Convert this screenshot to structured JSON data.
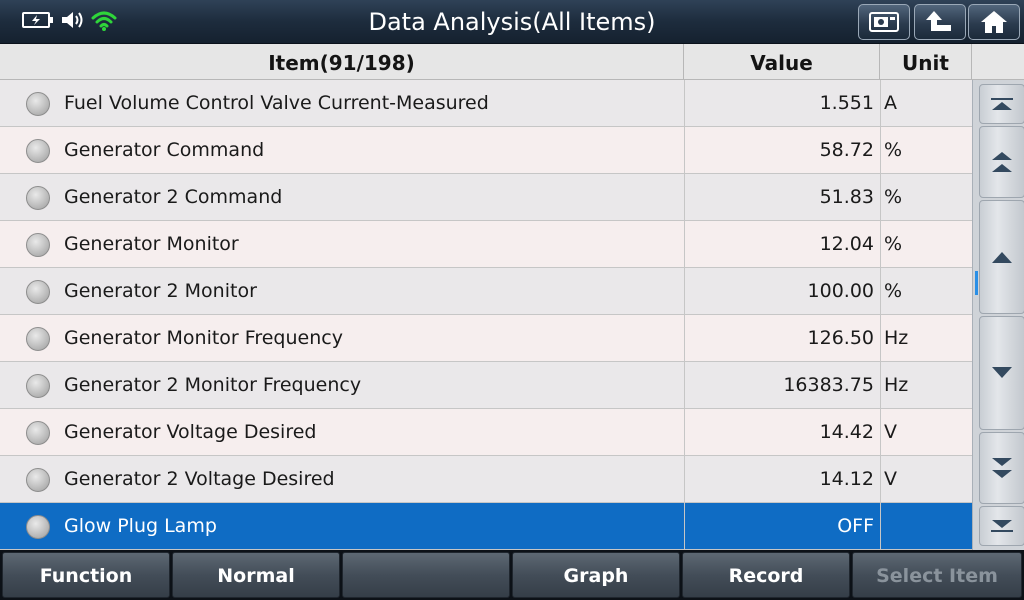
{
  "title": "Data Analysis(All Items)",
  "status_icons": [
    "battery-charging-icon",
    "speaker-icon",
    "wifi-icon"
  ],
  "title_buttons": [
    "screenshot-icon",
    "back-icon",
    "home-icon"
  ],
  "table": {
    "headers": {
      "item": "Item(91/198)",
      "value": "Value",
      "unit": "Unit"
    },
    "rows": [
      {
        "name": "Fuel Volume Control Valve Current-Measured",
        "value": "1.551",
        "unit": "A",
        "selected": false
      },
      {
        "name": "Generator Command",
        "value": "58.72",
        "unit": "%",
        "selected": false
      },
      {
        "name": "Generator 2 Command",
        "value": "51.83",
        "unit": "%",
        "selected": false
      },
      {
        "name": "Generator Monitor",
        "value": "12.04",
        "unit": "%",
        "selected": false
      },
      {
        "name": "Generator 2 Monitor",
        "value": "100.00",
        "unit": "%",
        "selected": false
      },
      {
        "name": "Generator Monitor Frequency",
        "value": "126.50",
        "unit": "Hz",
        "selected": false
      },
      {
        "name": "Generator 2 Monitor Frequency",
        "value": "16383.75",
        "unit": "Hz",
        "selected": false
      },
      {
        "name": "Generator Voltage Desired",
        "value": "14.42",
        "unit": "V",
        "selected": false
      },
      {
        "name": "Generator 2 Voltage Desired",
        "value": "14.12",
        "unit": "V",
        "selected": false
      },
      {
        "name": "Glow Plug Lamp",
        "value": "OFF",
        "unit": "",
        "selected": true
      }
    ]
  },
  "scroll_buttons": [
    "scroll-top-icon",
    "page-up-icon",
    "line-up-icon",
    "line-down-icon",
    "page-down-icon",
    "scroll-bottom-icon"
  ],
  "footer": {
    "function": "Function",
    "normal": "Normal",
    "blank": "",
    "graph": "Graph",
    "record": "Record",
    "select_item": "Select Item"
  },
  "colors": {
    "selected_row": "#0f6cc4",
    "scroll_thumb": "#2a8fe6",
    "wifi": "#2fd63a"
  }
}
